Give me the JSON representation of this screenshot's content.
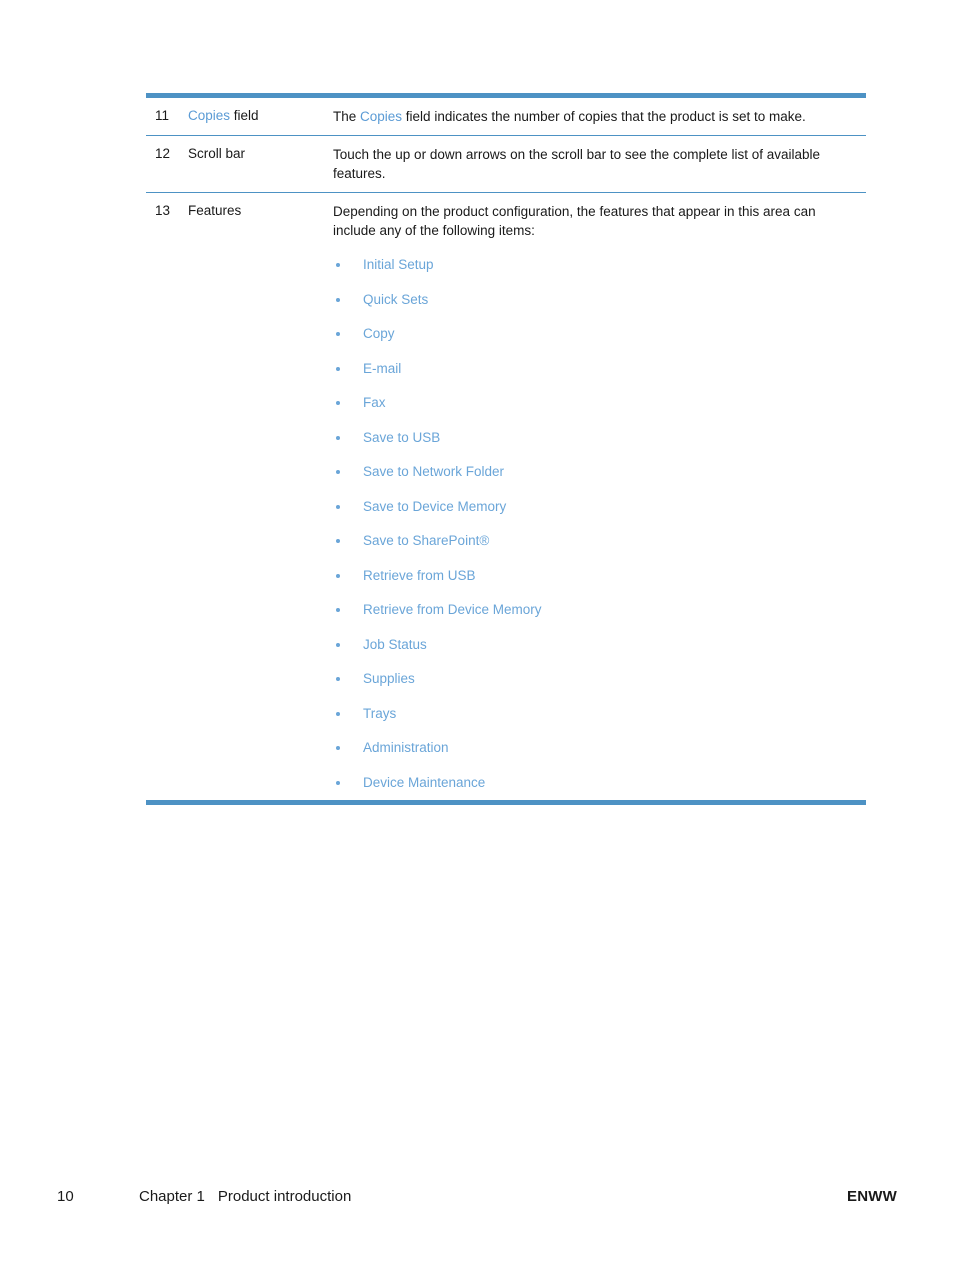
{
  "table": {
    "rows": [
      {
        "number": "11",
        "label_blue": "Copies",
        "label_rest": " field",
        "desc_pre": "The ",
        "desc_blue": "Copies",
        "desc_post": " field indicates the number of copies that the product is set to make."
      },
      {
        "number": "12",
        "label": "Scroll bar",
        "desc": "Touch the up or down arrows on the scroll bar to see the complete list of available features."
      },
      {
        "number": "13",
        "label": "Features",
        "desc": "Depending on the product configuration, the features that appear in this area can include any of the following items:",
        "features": [
          "Initial Setup",
          "Quick Sets",
          "Copy",
          "E-mail",
          "Fax",
          "Save to USB",
          "Save to Network Folder",
          "Save to Device Memory",
          "Save to SharePoint®",
          "Retrieve from USB",
          "Retrieve from Device Memory",
          "Job Status",
          "Supplies",
          "Trays",
          "Administration",
          "Device Maintenance"
        ]
      }
    ]
  },
  "footer": {
    "page_number": "10",
    "chapter": "Chapter 1",
    "chapter_title": "Product introduction",
    "right_label": "ENWW"
  },
  "colors": {
    "rule": "#4d92c4",
    "link_blue": "#5b9bd5",
    "list_blue": "#6aa5d8",
    "text": "#1a1a1a"
  }
}
